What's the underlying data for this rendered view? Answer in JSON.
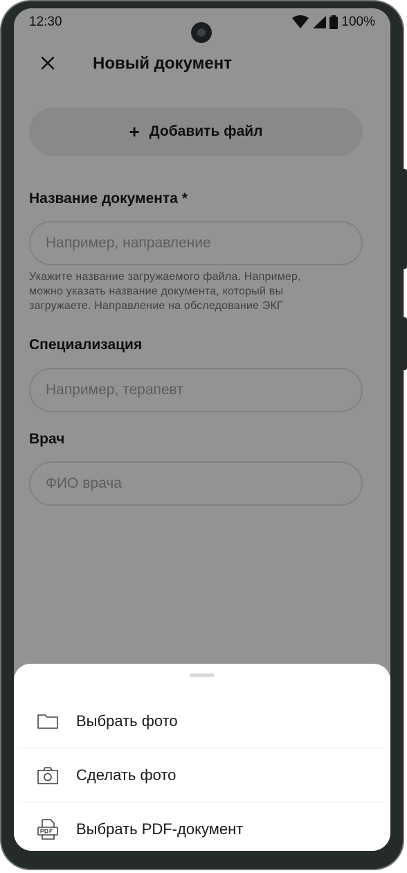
{
  "status_bar": {
    "time": "12:30",
    "battery": "100%"
  },
  "app_bar": {
    "title": "Новый документ"
  },
  "add_file": {
    "plus": "+",
    "label": "Добавить файл"
  },
  "form": {
    "doc_name": {
      "label": "Название документа *",
      "placeholder": "Например, направление",
      "hint_lines": [
        "Укажите название загружаемого файла. Например,",
        "можно указать название документа, который вы",
        "загружаете.  Направление на обследование ЭКГ"
      ]
    },
    "specialization": {
      "label": "Специализация",
      "placeholder": "Например, терапевт"
    },
    "doctor": {
      "label": "Врач",
      "placeholder": "ФИО врача"
    }
  },
  "bottom_sheet": {
    "items": [
      {
        "label": "Выбрать фото",
        "icon": "folder-icon"
      },
      {
        "label": "Сделать фото",
        "icon": "camera-icon"
      },
      {
        "label": "Выбрать PDF-документ",
        "icon": "pdf-icon"
      }
    ]
  },
  "colors": {
    "scrim": "#000000",
    "sheet": "#ffffff",
    "text": "#1a1a1a",
    "placeholder": "#9c9c9c"
  }
}
